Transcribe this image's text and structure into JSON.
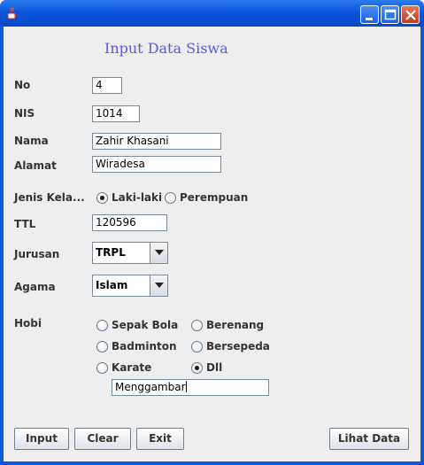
{
  "form": {
    "heading": "Input Data Siswa",
    "labels": {
      "no": "No",
      "nis": "NIS",
      "nama": "Nama",
      "alamat": "Alamat",
      "jenis_kelamin": "Jenis Kela...",
      "ttl": "TTL",
      "jurusan": "Jurusan",
      "agama": "Agama",
      "hobi": "Hobi"
    },
    "values": {
      "no": "4",
      "nis": "1014",
      "nama": "Zahir Khasani",
      "alamat": "Wiradesa",
      "ttl": "120596",
      "jurusan": "TRPL",
      "agama": "Islam",
      "hobi_lain": "Menggambar"
    },
    "gender": {
      "options": [
        "Laki-laki",
        "Perempuan"
      ],
      "selected": "Laki-laki"
    },
    "hobi": {
      "options": [
        "Sepak Bola",
        "Berenang",
        "Badminton",
        "Bersepeda",
        "Karate",
        "Dll"
      ],
      "selected": "Dll"
    }
  },
  "buttons": {
    "input": "Input",
    "clear": "Clear",
    "exit": "Exit",
    "lihat_data": "Lihat Data"
  },
  "icons": {
    "app": "java-cup-icon",
    "minimize": "minimize-icon",
    "maximize": "maximize-icon",
    "close": "close-icon"
  },
  "colors": {
    "title_bar": "#0a55d9",
    "heading": "#5a5ad8",
    "client_bg": "#eeeeee"
  }
}
